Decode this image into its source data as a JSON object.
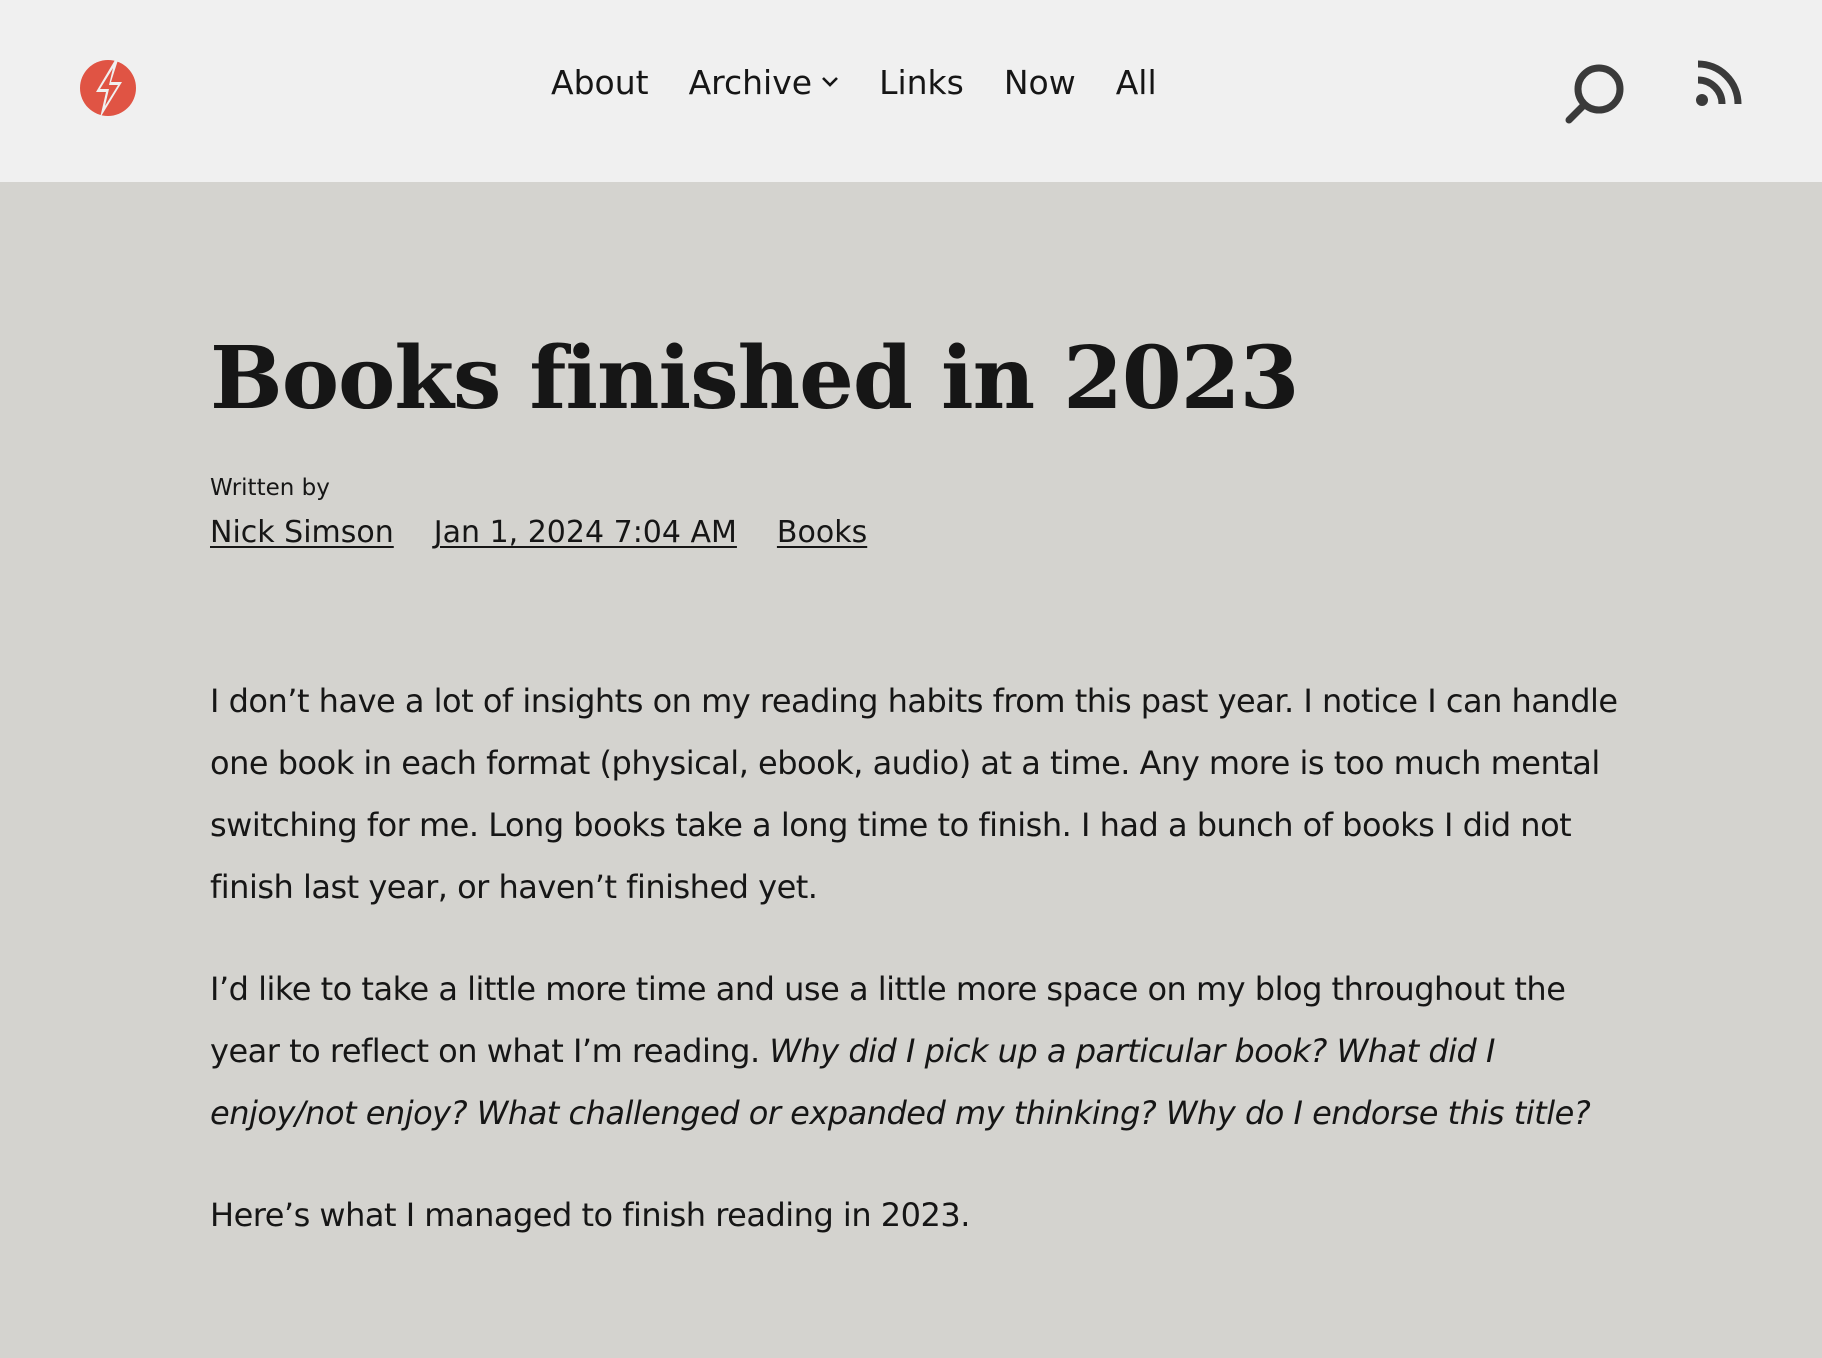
{
  "header": {
    "logo_color": "#e05444",
    "nav": [
      {
        "label": "About"
      },
      {
        "label": "Archive"
      },
      {
        "label": "Links"
      },
      {
        "label": "Now"
      },
      {
        "label": "All"
      }
    ],
    "icons": {
      "logo": "bolt-logo-icon",
      "search": "search-icon",
      "rss": "rss-icon",
      "archive_dropdown": "chevron-down-icon"
    }
  },
  "post": {
    "title": "Books finished in 2023",
    "written_by_label": "Written by",
    "author": "Nick Simson",
    "date": "Jan 1, 2024 7:04 AM",
    "category": "Books",
    "paragraphs": {
      "p1": "I don’t have a lot of insights on my reading habits from this past year. I notice I can handle one book in each format (physical, ebook, audio) at a time. Any more is too much mental switching for me. Long books take a long time to finish. I had a bunch of books I did not finish last year, or haven’t finished yet.",
      "p2_plain": "I’d like to take a little more time and use a little more space on my blog throughout the year to reflect on what I’m reading. ",
      "p2_italic": "Why did I pick up a particular book? What did I enjoy/not enjoy? What challenged or expanded my thinking? Why do I endorse this title?",
      "p3": "Here’s what I managed to finish reading in 2023."
    }
  }
}
